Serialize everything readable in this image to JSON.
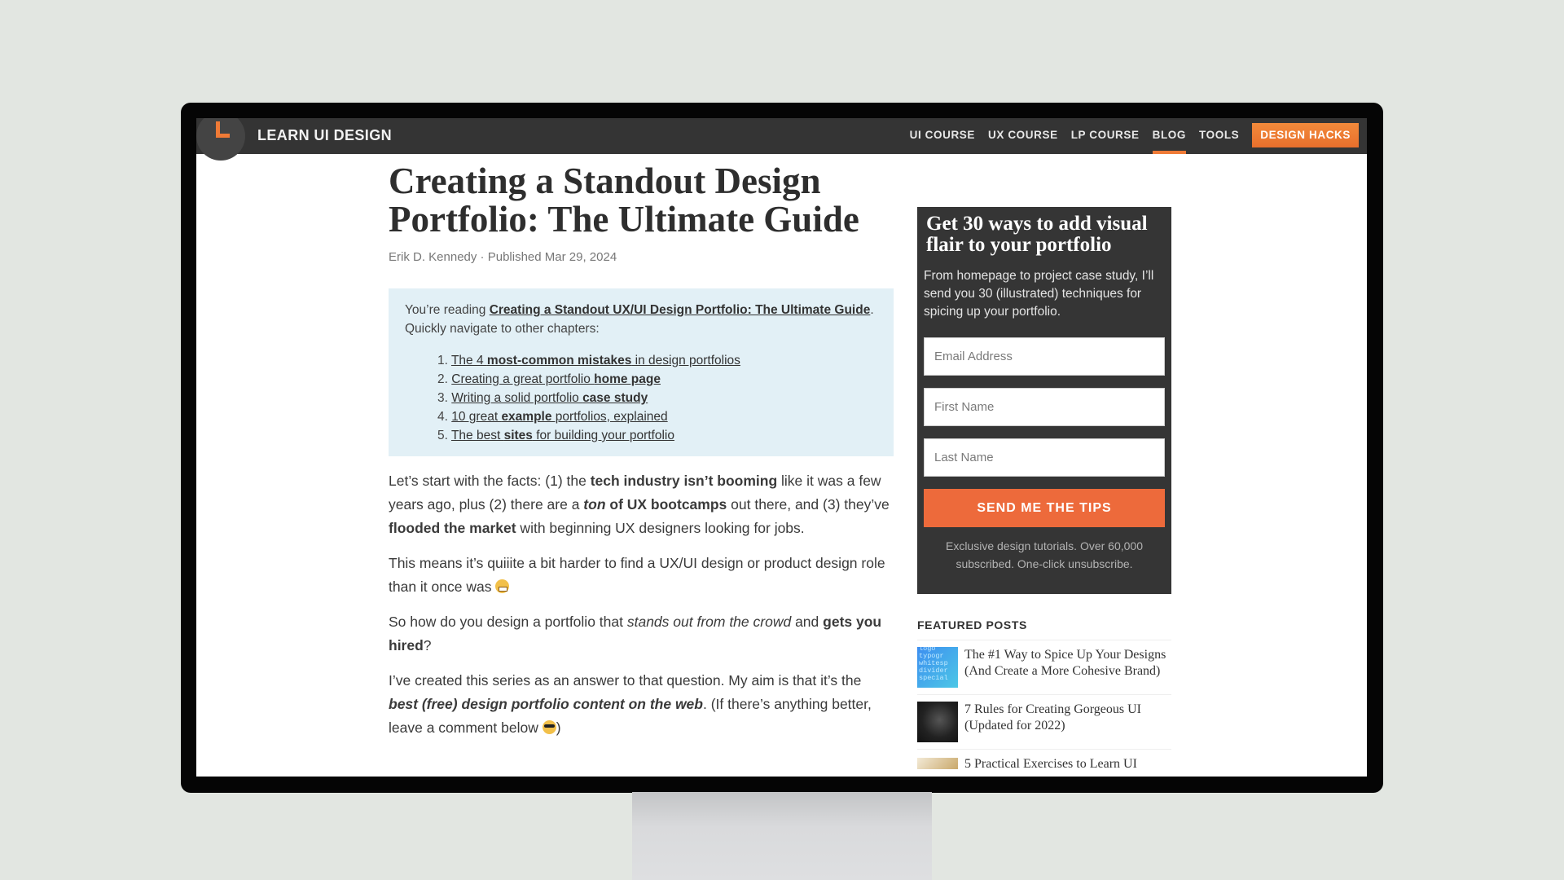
{
  "nav": {
    "brand": "LEARN UI DESIGN",
    "links": [
      {
        "label": "UI COURSE",
        "active": false
      },
      {
        "label": "UX COURSE",
        "active": false
      },
      {
        "label": "LP COURSE",
        "active": false
      },
      {
        "label": "BLOG",
        "active": true
      },
      {
        "label": "TOOLS",
        "active": false
      }
    ],
    "cta": "DESIGN HACKS",
    "accent_color": "#ef7a36"
  },
  "article": {
    "title": "Creating a Standout Design Portfolio: The Ultimate Guide",
    "author": "Erik D. Kennedy",
    "separator": " · ",
    "published": "Published Mar 29, 2024",
    "toc": {
      "intro_prefix": "You’re reading ",
      "series_link": "Creating a Standout UX/UI Design Portfolio: The Ultimate Guide",
      "intro_suffix": ". Quickly navigate to other chapters:",
      "items": [
        {
          "num": "1.",
          "pre": "The 4 ",
          "bold": "most-common mistakes",
          "post": " in design portfolios"
        },
        {
          "num": "2.",
          "pre": "Creating a great portfolio ",
          "bold": "home page",
          "post": ""
        },
        {
          "num": "3.",
          "pre": "Writing a solid portfolio ",
          "bold": "case study",
          "post": ""
        },
        {
          "num": "4.",
          "pre": "10 great ",
          "bold": "example",
          "post": " portfolios, explained"
        },
        {
          "num": "5.",
          "pre": "The best ",
          "bold": "sites",
          "post": " for building your portfolio"
        }
      ]
    },
    "paragraphs": {
      "p1": {
        "a": "Let’s start with the facts: (1) the ",
        "b": "tech industry isn’t booming",
        "c": " like it was a few years ago, plus (2) there are a ",
        "d_italic": "ton",
        "d_bold": " of UX bootcamps",
        "e": " out there, and (3) they’ve ",
        "f": "flooded the market",
        "g": " with beginning UX designers looking for jobs."
      },
      "p2": {
        "a": "This means it’s quiiite a bit harder to find a UX/UI design or product design role than it once was ",
        "emoji": "grimacing-face-emoji"
      },
      "p3": {
        "a": "So how do you design a portfolio that ",
        "b_italic": "stands out from the crowd",
        "c": " and ",
        "d_bold": "gets you hired",
        "e": "?"
      },
      "p4": {
        "a": "I’ve created this series as an answer to that question. My aim is that it’s the ",
        "b_bolditalic": "best (free) design portfolio content on the web",
        "c": ". (If there’s anything better, leave a comment below ",
        "emoji": "sunglasses-face-emoji",
        "d": ")"
      }
    }
  },
  "signup": {
    "title": "Get 30 ways to add visual flair to your portfolio",
    "description": "From homepage to project case study, I’ll send you 30 (illustrated) techniques for spicing up your portfolio.",
    "email_placeholder": "Email Address",
    "first_name_placeholder": "First Name",
    "last_name_placeholder": "Last Name",
    "button": "SEND ME THE TIPS",
    "note": "Exclusive design tutorials. Over 60,000 subscribed. One-click unsubscribe.",
    "button_color": "#ed6a3b"
  },
  "featured": {
    "heading": "FEATURED POSTS",
    "posts": [
      {
        "title": "The #1 Way to Spice Up Your Designs (And Create a More Cohesive Brand)",
        "thumb": "typography-thumbnail"
      },
      {
        "title": "7 Rules for Creating Gorgeous UI (Updated for 2022)",
        "thumb": "ui-screens-thumbnail"
      },
      {
        "title": "5 Practical Exercises to Learn UI",
        "thumb": "exercise-thumbnail"
      }
    ]
  }
}
